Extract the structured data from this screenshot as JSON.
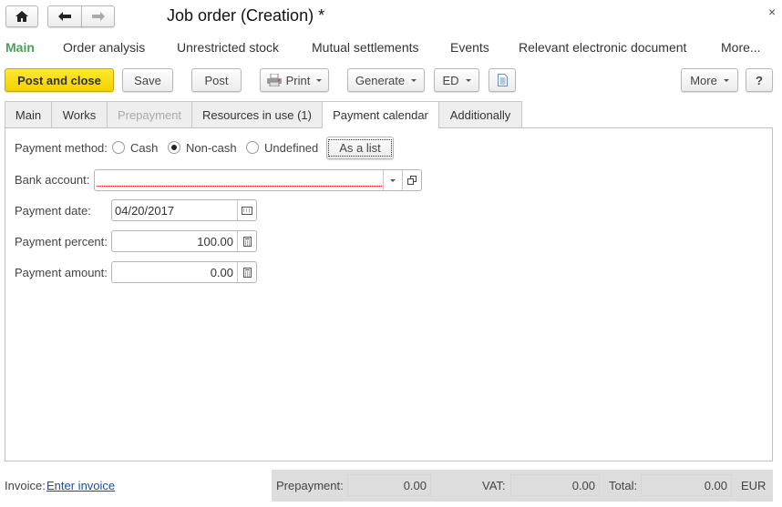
{
  "window": {
    "title": "Job order (Creation) *",
    "close": "×"
  },
  "nav": [
    "Main",
    "Order analysis",
    "Unrestricted stock",
    "Mutual settlements",
    "Events",
    "Relevant electronic document",
    "More..."
  ],
  "toolbar": {
    "post_close": "Post and close",
    "save": "Save",
    "post": "Post",
    "print": "Print",
    "generate": "Generate",
    "ed": "ED",
    "more": "More",
    "help": "?"
  },
  "tabs": [
    "Main",
    "Works",
    "Prepayment",
    "Resources in use (1)",
    "Payment calendar",
    "Additionally"
  ],
  "form": {
    "payment_method_label": "Payment method:",
    "methods": [
      "Cash",
      "Non-cash",
      "Undefined"
    ],
    "selected_method": "Non-cash",
    "as_list": "As a list",
    "bank_account_label": "Bank account:",
    "bank_account_value": "",
    "payment_date_label": "Payment date:",
    "payment_date": "04/20/2017",
    "payment_percent_label": "Payment percent:",
    "payment_percent": "100.00",
    "payment_amount_label": "Payment amount:",
    "payment_amount": "0.00"
  },
  "footer": {
    "invoice_label": "Invoice:",
    "invoice_link": "Enter invoice",
    "prepayment_label": "Prepayment:",
    "prepayment": "0.00",
    "vat_label": "VAT:",
    "vat": "0.00",
    "total_label": "Total:",
    "total": "0.00",
    "currency": "EUR"
  },
  "colors": {
    "accent_green": "#4a9e5c",
    "primary_button": "#f5d800",
    "link": "#1a4d9e",
    "error_underline": "#e00000"
  }
}
